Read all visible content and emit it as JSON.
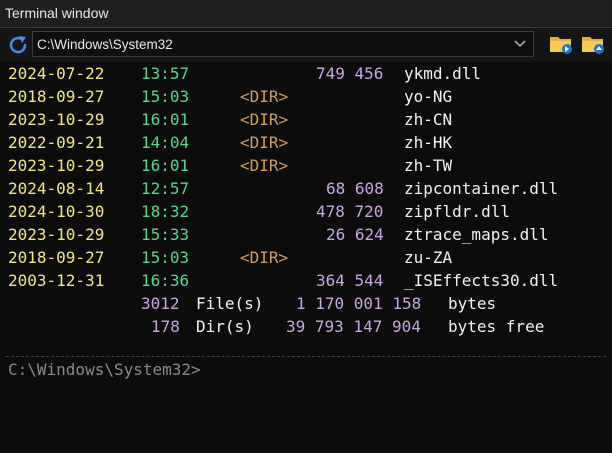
{
  "window": {
    "title": "Terminal window"
  },
  "pathbar": {
    "path": "C:\\Windows\\System32"
  },
  "listing": [
    {
      "date": "2024-07-22",
      "time": "13:57",
      "dir": "",
      "size": "749 456",
      "name": "ykmd.dll"
    },
    {
      "date": "2018-09-27",
      "time": "15:03",
      "dir": "<DIR>",
      "size": "",
      "name": "yo-NG"
    },
    {
      "date": "2023-10-29",
      "time": "16:01",
      "dir": "<DIR>",
      "size": "",
      "name": "zh-CN"
    },
    {
      "date": "2022-09-21",
      "time": "14:04",
      "dir": "<DIR>",
      "size": "",
      "name": "zh-HK"
    },
    {
      "date": "2023-10-29",
      "time": "16:01",
      "dir": "<DIR>",
      "size": "",
      "name": "zh-TW"
    },
    {
      "date": "2024-08-14",
      "time": "12:57",
      "dir": "",
      "size": "68 608",
      "name": "zipcontainer.dll"
    },
    {
      "date": "2024-10-30",
      "time": "18:32",
      "dir": "",
      "size": "478 720",
      "name": "zipfldr.dll"
    },
    {
      "date": "2023-10-29",
      "time": "15:33",
      "dir": "",
      "size": "26 624",
      "name": "ztrace_maps.dll"
    },
    {
      "date": "2018-09-27",
      "time": "15:03",
      "dir": "<DIR>",
      "size": "",
      "name": "zu-ZA"
    },
    {
      "date": "2003-12-31",
      "time": "16:36",
      "dir": "",
      "size": "364 544",
      "name": "_ISEffects30.dll"
    }
  ],
  "summary": {
    "files_count": "3012",
    "files_label": "File(s)",
    "files_bytes": "1 170 001 158",
    "files_unit": "bytes",
    "dirs_count": "178",
    "dirs_label": "Dir(s)",
    "dirs_bytes": "39 793 147 904",
    "dirs_unit": "bytes free"
  },
  "prompt": {
    "text": "C:\\Windows\\System32>"
  },
  "colors": {
    "date": "#f0e68c",
    "time": "#5bd68a",
    "dir": "#d19a66",
    "size": "#c7a6e6",
    "name": "#f2f2f2",
    "background": "#0c0c0c"
  },
  "icons": {
    "refresh": "refresh-icon",
    "dropdown": "chevron-down-icon",
    "folder_open": "folder-go-icon",
    "folder_up": "folder-up-icon"
  }
}
